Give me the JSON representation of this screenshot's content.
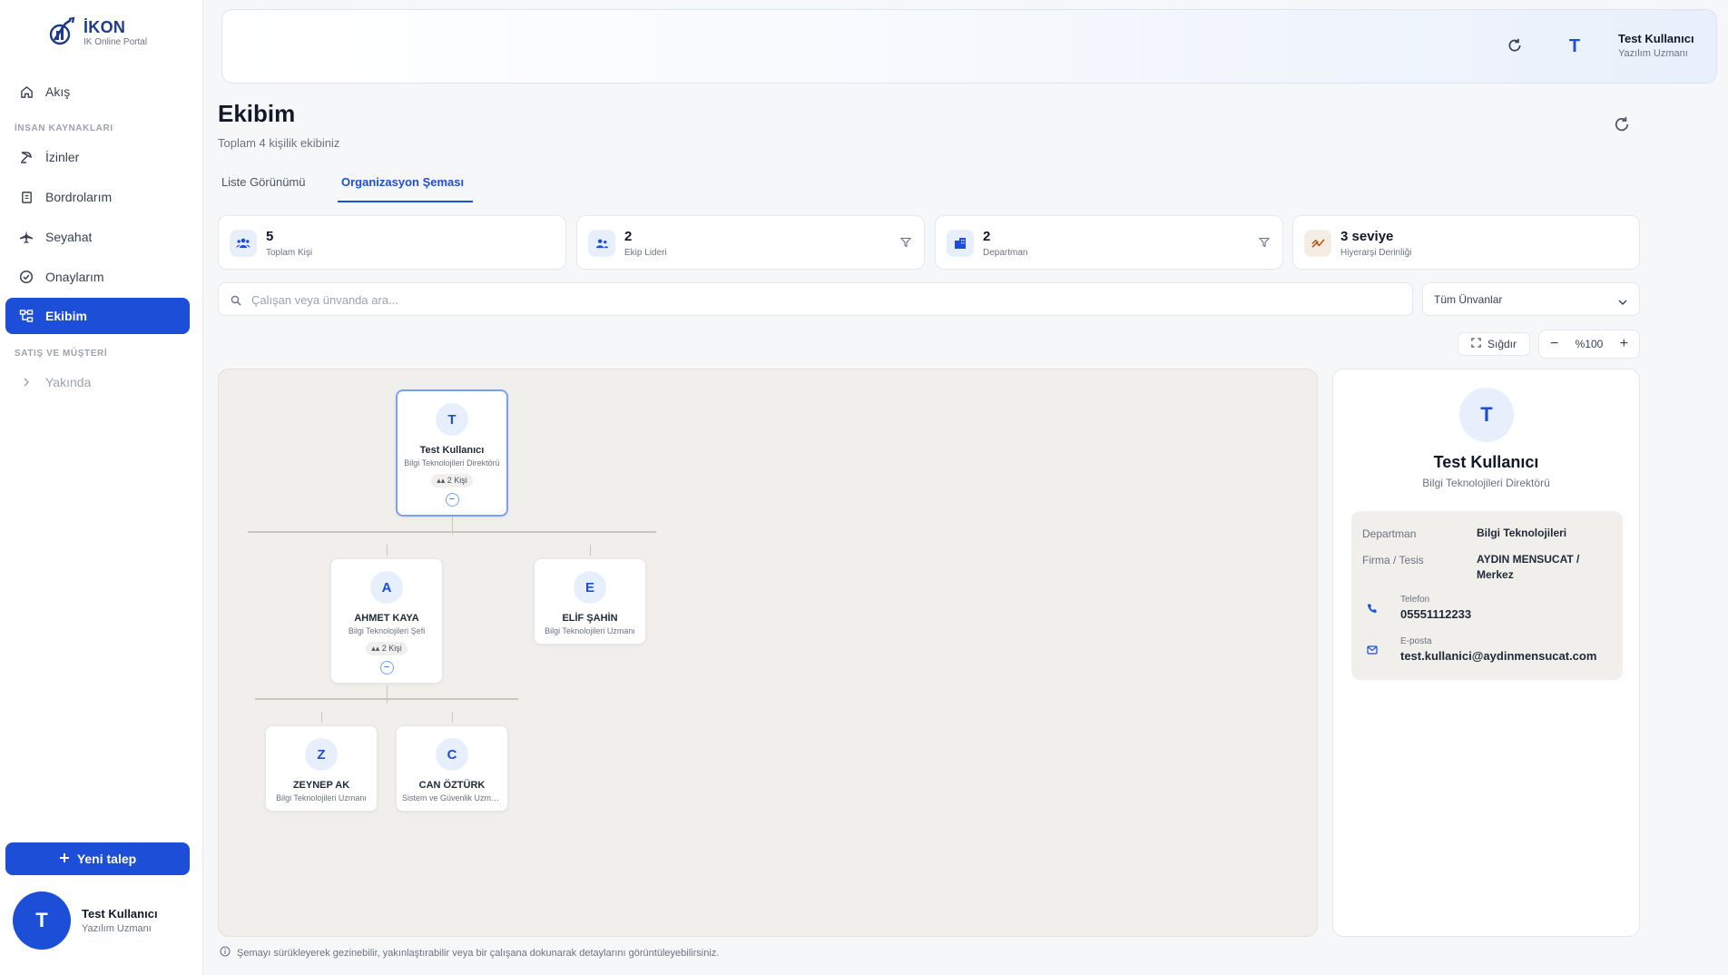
{
  "brand": {
    "name": "İKON",
    "subtitle": "IK Online Portal"
  },
  "sidebar": {
    "items": [
      {
        "label": "Akış",
        "icon": "home-icon"
      },
      {
        "label": "İzinler",
        "icon": "leave-icon"
      },
      {
        "label": "Bordrolarım",
        "icon": "payroll-icon"
      },
      {
        "label": "Seyahat",
        "icon": "plane-icon"
      },
      {
        "label": "Onaylarım",
        "icon": "check-circle-icon"
      },
      {
        "label": "Ekibim",
        "icon": "org-chart-icon",
        "active": true
      },
      {
        "label": "Yakında",
        "icon": "chevron-right-icon"
      }
    ],
    "sections": {
      "hr": "İNSAN KAYNAKLARI",
      "sales": "SATIŞ VE MÜŞTERİ"
    },
    "new_request": "Yeni talep",
    "user": {
      "initial": "T",
      "name": "Test Kullanıcı",
      "role": "Yazılım Uzmanı"
    }
  },
  "topbar": {
    "initial": "T",
    "name": "Test Kullanıcı",
    "role": "Yazılım Uzmanı"
  },
  "page": {
    "title": "Ekibim",
    "subtitle": "Toplam 4 kişilik ekibiniz"
  },
  "tabs": [
    {
      "label": "Liste Görünümü"
    },
    {
      "label": "Organizasyon Şeması",
      "active": true
    }
  ],
  "stats": [
    {
      "value": "5",
      "label": "Toplam Kişi",
      "icon": "users-icon",
      "color": "#1d4ed8",
      "bg": "#e8effc"
    },
    {
      "value": "2",
      "label": "Ekip Lideri",
      "icon": "team-leader-icon",
      "color": "#1d4ed8",
      "bg": "#e8effc",
      "filter": true
    },
    {
      "value": "2",
      "label": "Departman",
      "icon": "building-icon",
      "color": "#1d4ed8",
      "bg": "#e8effc",
      "filter": true
    },
    {
      "value": "3 seviye",
      "label": "Hiyerarşi Derinliği",
      "icon": "hierarchy-icon",
      "color": "#b45309",
      "bg": "#f5ede4"
    }
  ],
  "search": {
    "placeholder": "Çalışan veya ünvanda ara..."
  },
  "title_filter": {
    "value": "Tüm Ünvanlar"
  },
  "controls": {
    "fit": "Sığdır",
    "zoom": "%100"
  },
  "org": {
    "root": {
      "initial": "T",
      "name": "Test Kullanıcı",
      "title": "Bilgi Teknolojileri Direktörü",
      "count": "2 Kişi"
    },
    "level2": [
      {
        "initial": "A",
        "name": "AHMET KAYA",
        "title": "Bilgi Teknolojileri Şefi",
        "count": "2 Kişi"
      },
      {
        "initial": "E",
        "name": "ELİF ŞAHİN",
        "title": "Bilgi Teknolojileri Uzmanı"
      }
    ],
    "level3": [
      {
        "initial": "Z",
        "name": "ZEYNEP AK",
        "title": "Bilgi Teknolojileri Uzmanı"
      },
      {
        "initial": "C",
        "name": "CAN ÖZTÜRK",
        "title": "Sistem ve Güvenlik Uzmanı"
      }
    ]
  },
  "detail": {
    "initial": "T",
    "name": "Test Kullanıcı",
    "role": "Bilgi Teknolojileri Direktörü",
    "department_label": "Departman",
    "department": "Bilgi Teknolojileri",
    "company_label": "Firma / Tesis",
    "company": "AYDIN MENSUCAT / Merkez",
    "phone_label": "Telefon",
    "phone": "05551112233",
    "email_label": "E-posta",
    "email": "test.kullanici@aydinmensucat.com"
  },
  "footer_note": "Şemayı sürükleyerek gezinebilir, yakınlaştırabilir veya bir çalışana dokunarak detaylarını görüntüleyebilirsiniz."
}
